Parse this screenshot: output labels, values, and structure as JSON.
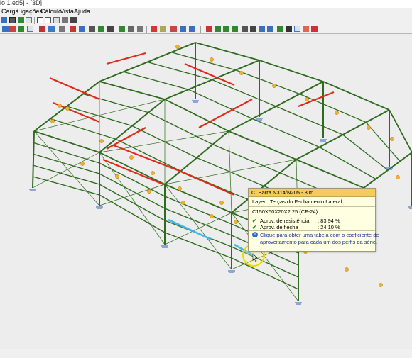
{
  "window": {
    "title": "io 1.ed5] - [3D]"
  },
  "menu": {
    "items": [
      "Carga",
      "Ligações",
      "Cálculo",
      "Vista",
      "Ajuda"
    ]
  },
  "tooltip": {
    "header": "C: Barra N314/N205 - 3 m",
    "layer": "Layer : Terças do Fechamento Lateral",
    "profile": "C150X60X20X2.25 (CF-24)",
    "resistance_label": "Aprov. de resistência",
    "resistance_value": ": 83.94 %",
    "deflection_label": "Aprov. de flecha",
    "deflection_value": ": 24.10 %",
    "info_line1": "Clique para obter uma tabela com o coeficiente de",
    "info_line2": "aproveitamento para cada um dos perfis da série."
  },
  "colors": {
    "member": "#2f6b1e",
    "highlight_red": "#e02a1a",
    "selected": "#3fb7e8",
    "node_marker": "#f0b030"
  }
}
